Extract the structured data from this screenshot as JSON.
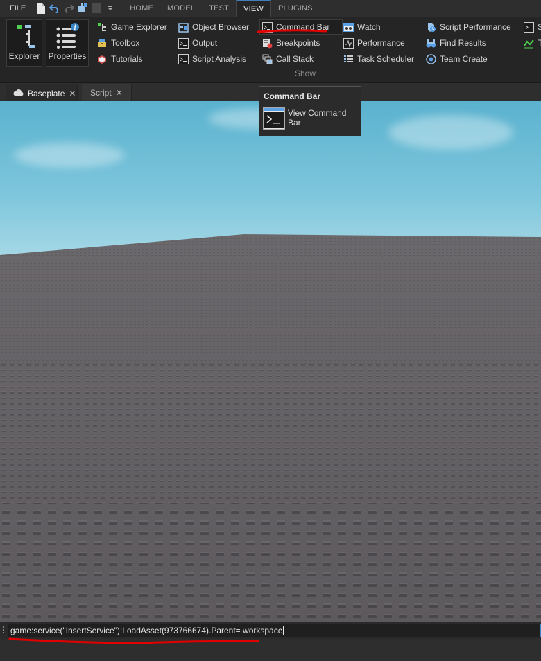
{
  "menu": {
    "file": "FILE",
    "tabs": [
      "HOME",
      "MODEL",
      "TEST",
      "VIEW",
      "PLUGINS"
    ],
    "active_tab": "VIEW"
  },
  "ribbon": {
    "explorer_label": "Explorer",
    "properties_label": "Properties",
    "col1": [
      "Game Explorer",
      "Toolbox",
      "Tutorials"
    ],
    "col2": [
      "Object Browser",
      "Output",
      "Script Analysis"
    ],
    "col3": [
      "Command Bar",
      "Breakpoints",
      "Call Stack"
    ],
    "col4": [
      "Watch",
      "Performance",
      "Task Scheduler"
    ],
    "col5": [
      "Script Performance",
      "Find Results",
      "Team Create"
    ],
    "col6": [
      "S",
      "T"
    ],
    "group_label": "Show"
  },
  "doc_tabs": [
    {
      "label": "Baseplate",
      "icon": "cloud-icon",
      "active": true
    },
    {
      "label": "Script",
      "icon": "",
      "active": false
    }
  ],
  "tooltip": {
    "title": "Command Bar",
    "text": "View Command Bar"
  },
  "command_bar": {
    "value": "game:service(\"InsertService\"):LoadAsset(973766674).Parent= workspace"
  },
  "colors": {
    "accent_blue": "#3d86c6",
    "annotation_red": "#e00000",
    "ground": "#5f5c60"
  }
}
